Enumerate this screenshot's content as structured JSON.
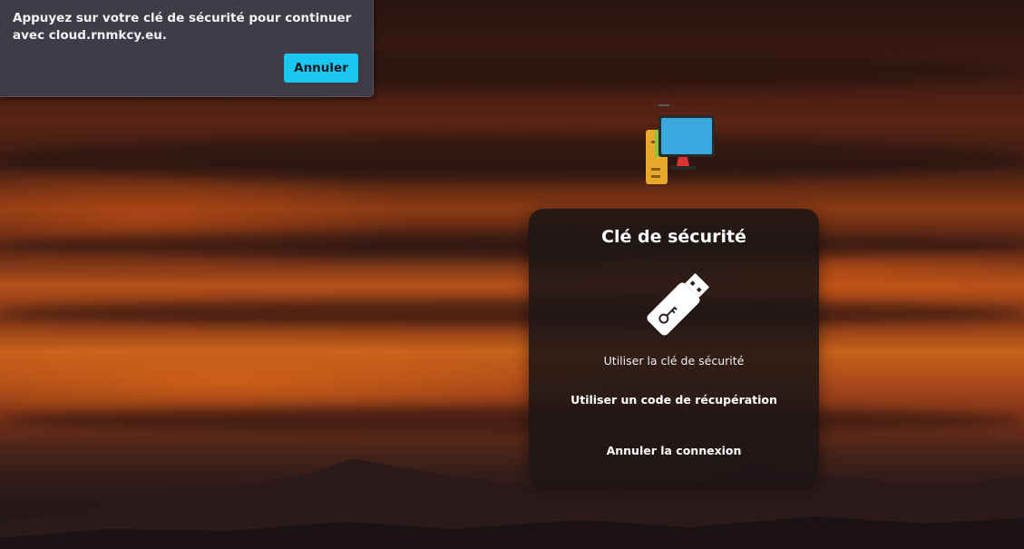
{
  "dialog": {
    "message": "Appuyez sur votre clé de sécurité pour continuer avec cloud.rnmkcy.eu.",
    "cancel_label": "Annuler",
    "accent": "#1ac6f2"
  },
  "card": {
    "title": "Clé de sécurité",
    "use_key_label": "Utiliser la clé de sécurité",
    "recovery_label": "Utiliser un code de récupération",
    "cancel_login_label": "Annuler la connexion",
    "icon": "usb-security-key-icon"
  },
  "logo": {
    "icon": "computer-logo-icon"
  }
}
